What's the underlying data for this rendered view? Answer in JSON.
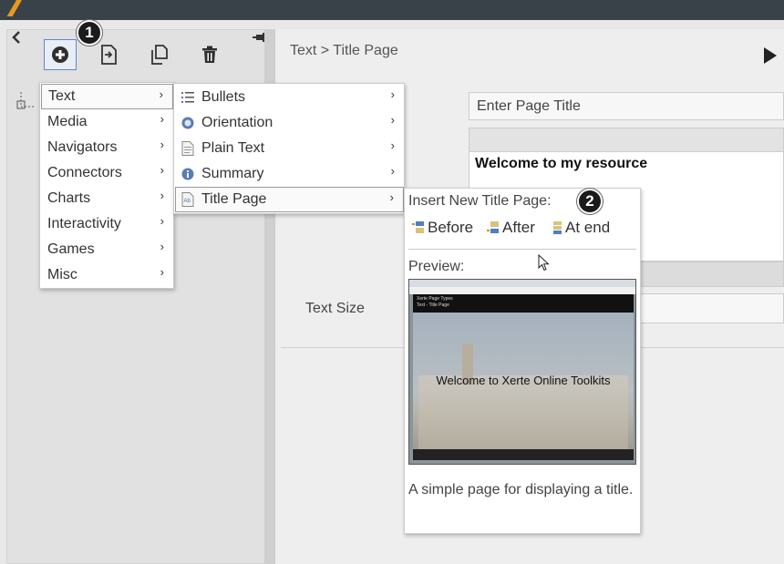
{
  "toolbar": {
    "add_icon": "plus-circle-icon",
    "insert_icon": "insert-page-icon",
    "duplicate_icon": "duplicate-icon",
    "delete_icon": "trash-icon",
    "collapse_icon": "chevron-left-icon",
    "pin_icon": "pin-icon"
  },
  "badges": {
    "one": "1",
    "two": "2"
  },
  "breadcrumb": "Text > Title Page",
  "editor": {
    "title_placeholder": "Enter Page Title",
    "body_text": "Welcome to my resource",
    "text_size_label": "Text Size"
  },
  "menu": {
    "categories": [
      "Text",
      "Media",
      "Navigators",
      "Connectors",
      "Charts",
      "Interactivity",
      "Games",
      "Misc"
    ],
    "submenu": [
      "Bullets",
      "Orientation",
      "Plain Text",
      "Summary",
      "Title Page"
    ]
  },
  "flyout": {
    "heading": "Insert New Title Page:",
    "before": "Before",
    "after": "After",
    "at_end": "At end",
    "preview_label": "Preview:",
    "preview_image_text": "Welcome to Xerte Online Toolkits",
    "preview_header_line1": "Xerte Page Types",
    "preview_header_line2": "Text - Title Page",
    "description": "A simple page for displaying a title."
  },
  "colors": {
    "accent": "#5a88c9",
    "topbar": "#394249",
    "brand": "#e59b1e"
  }
}
